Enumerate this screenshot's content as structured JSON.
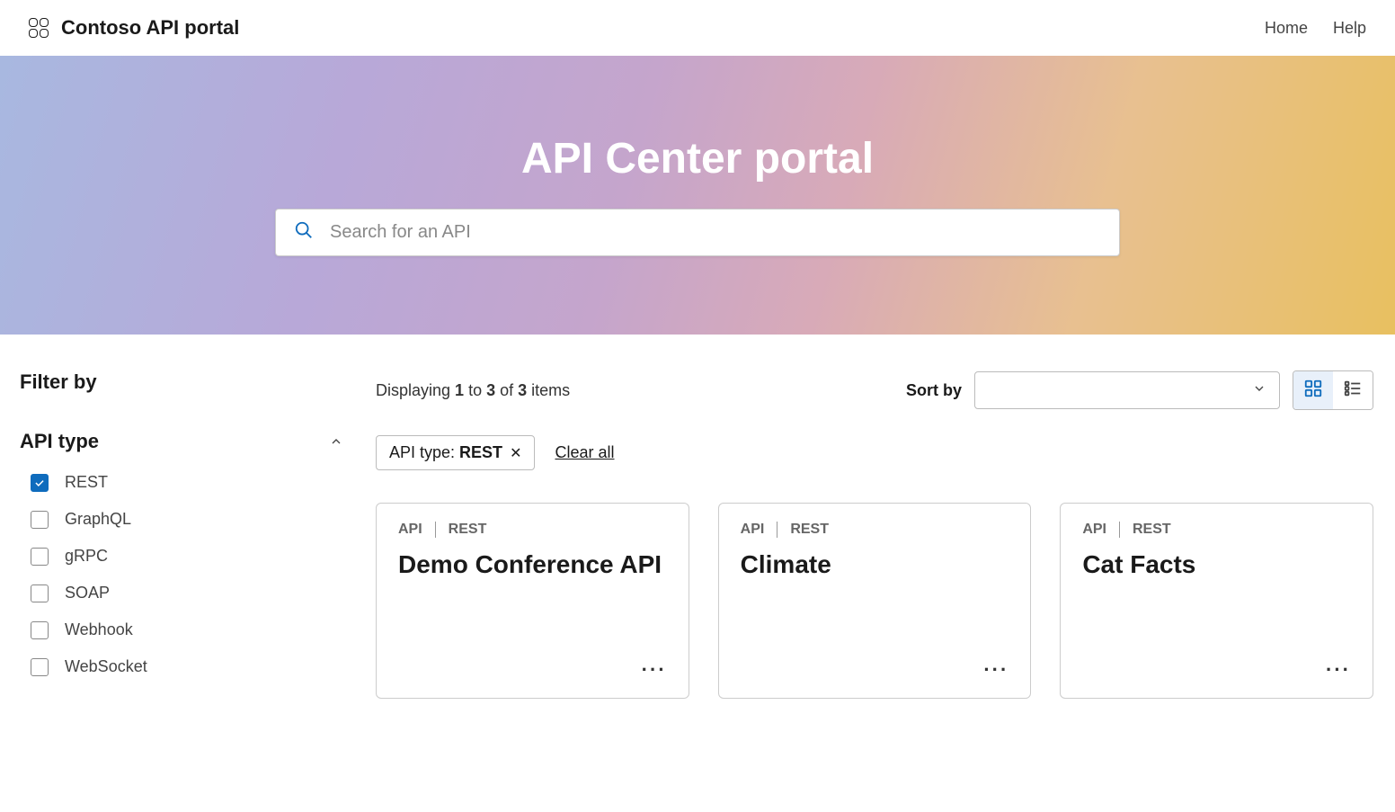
{
  "header": {
    "brand": "Contoso API portal",
    "nav": [
      "Home",
      "Help"
    ]
  },
  "hero": {
    "title": "API Center portal",
    "search_placeholder": "Search for an API"
  },
  "sidebar": {
    "filter_title": "Filter by",
    "group": {
      "title": "API type",
      "options": [
        {
          "label": "REST",
          "checked": true
        },
        {
          "label": "GraphQL",
          "checked": false
        },
        {
          "label": "gRPC",
          "checked": false
        },
        {
          "label": "SOAP",
          "checked": false
        },
        {
          "label": "Webhook",
          "checked": false
        },
        {
          "label": "WebSocket",
          "checked": false
        }
      ]
    }
  },
  "toolbar": {
    "displaying_prefix": "Displaying ",
    "from": "1",
    "to_word": " to ",
    "to": "3",
    "of_word": " of ",
    "total": "3",
    "items_word": " items",
    "sort_label": "Sort by"
  },
  "chips": {
    "api_type_label": "API type: ",
    "api_type_value": "REST",
    "clear_all": "Clear all"
  },
  "cards": [
    {
      "tag1": "API",
      "tag2": "REST",
      "title": "Demo Conference API"
    },
    {
      "tag1": "API",
      "tag2": "REST",
      "title": "Climate"
    },
    {
      "tag1": "API",
      "tag2": "REST",
      "title": "Cat Facts"
    }
  ]
}
